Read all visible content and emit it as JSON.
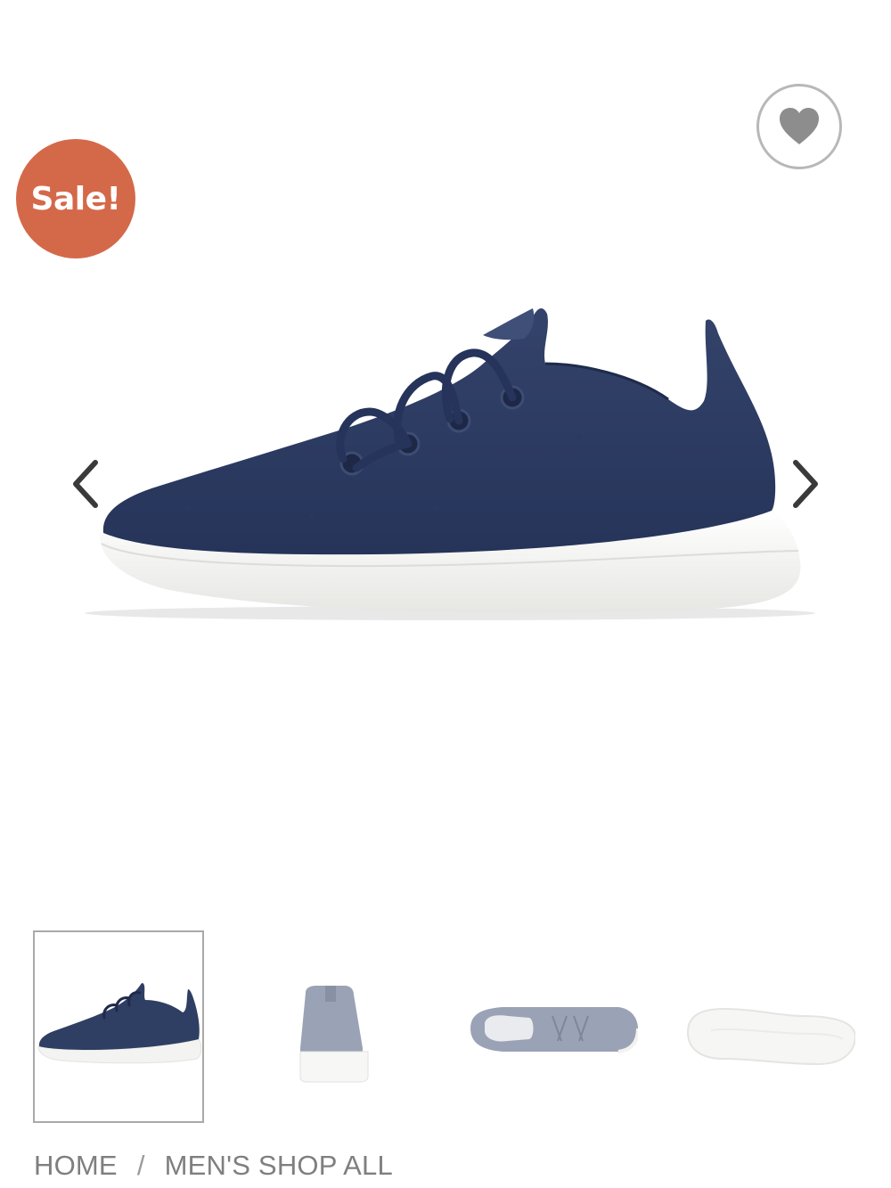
{
  "badge": {
    "sale_label": "Sale!",
    "color": "#d4694a"
  },
  "wishlist": {
    "icon": "heart-icon"
  },
  "gallery": {
    "prev_icon": "chevron-left-icon",
    "next_icon": "chevron-right-icon",
    "main_image": "navy-wool-runner-side-view",
    "thumbnails": [
      {
        "image": "navy-wool-runner-side-view",
        "selected": true
      },
      {
        "image": "grey-wool-runner-back-view",
        "selected": false
      },
      {
        "image": "grey-wool-runner-top-view",
        "selected": false
      },
      {
        "image": "white-sole-bottom-view",
        "selected": false
      }
    ]
  },
  "breadcrumb": {
    "items": [
      "HOME",
      "MEN'S SHOP ALL"
    ],
    "separator": "/"
  },
  "colors": {
    "shoe_navy": "#2f3e63",
    "sole_white": "#f3f3f1",
    "thumb_grey": "#9aa3b5",
    "text_grey": "#7f7f7f"
  }
}
